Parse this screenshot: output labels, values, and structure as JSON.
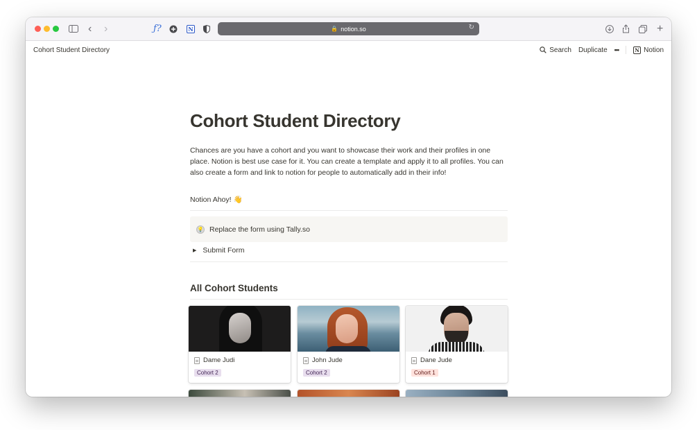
{
  "browser": {
    "url": "notion.so"
  },
  "topbar": {
    "page_title": "Cohort Student Directory",
    "search_label": "Search",
    "duplicate_label": "Duplicate",
    "more_label": "•••",
    "notion_label": "Notion"
  },
  "page": {
    "title": "Cohort Student Directory",
    "description": "Chances are you have a cohort and you want to showcase their work and their profiles in one place. Notion is best use case for it. You can create a template and apply it to all profiles. You can also create a form and link to notion for people to automatically add in their info!",
    "greeting": "Notion Ahoy! 👋",
    "callout_text": "Replace the form using Tally.so",
    "toggle_label": "Submit Form",
    "section_heading": "All Cohort Students"
  },
  "students": [
    {
      "name": "Dame Judi",
      "cohort": "Cohort 2"
    },
    {
      "name": "John Jude",
      "cohort": "Cohort 2"
    },
    {
      "name": "Dane Jude",
      "cohort": "Cohort 1"
    }
  ],
  "colors": {
    "accent_text": "#37352f",
    "cohort_2_tag_bg": "#e8deee",
    "cohort_1_tag_bg": "#ffe2dd"
  }
}
